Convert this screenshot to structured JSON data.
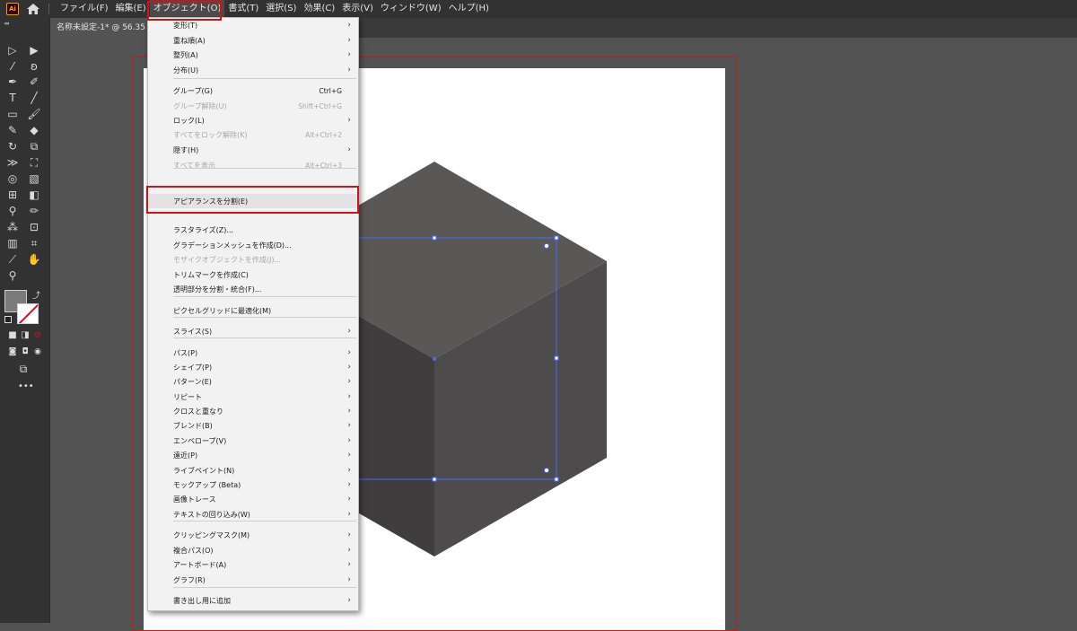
{
  "menubar": {
    "logo_text": "Ai",
    "items": [
      "ファイル(F)",
      "編集(E)",
      "オブジェクト(O)",
      "書式(T)",
      "選択(S)",
      "効果(C)",
      "表示(V)",
      "ウィンドウ(W)",
      "ヘルプ(H)"
    ]
  },
  "document": {
    "tab_title": "名称未設定-1* @ 56.35 %"
  },
  "object_menu": {
    "items": [
      {
        "label": "変形(T)",
        "shortcut": "",
        "submenu": true,
        "disabled": false
      },
      {
        "label": "重ね順(A)",
        "shortcut": "",
        "submenu": true,
        "disabled": false
      },
      {
        "label": "整列(A)",
        "shortcut": "",
        "submenu": true,
        "disabled": false
      },
      {
        "label": "分布(U)",
        "shortcut": "",
        "submenu": true,
        "disabled": false
      },
      {
        "label": "グループ(G)",
        "shortcut": "Ctrl+G",
        "submenu": false,
        "disabled": false
      },
      {
        "label": "グループ解除(U)",
        "shortcut": "Shift+Ctrl+G",
        "submenu": false,
        "disabled": true
      },
      {
        "label": "ロック(L)",
        "shortcut": "",
        "submenu": true,
        "disabled": false
      },
      {
        "label": "すべてをロック解除(K)",
        "shortcut": "Alt+Ctrl+2",
        "submenu": false,
        "disabled": true
      },
      {
        "label": "隠す(H)",
        "shortcut": "",
        "submenu": true,
        "disabled": false
      },
      {
        "label": "すべてを表示",
        "shortcut": "Alt+Ctrl+3",
        "submenu": false,
        "disabled": true
      },
      {
        "label": "アピアランスを分割(E)",
        "shortcut": "",
        "submenu": false,
        "disabled": false
      },
      {
        "label": "ラスタライズ(Z)...",
        "shortcut": "",
        "submenu": false,
        "disabled": false
      },
      {
        "label": "グラデーションメッシュを作成(D)...",
        "shortcut": "",
        "submenu": false,
        "disabled": false
      },
      {
        "label": "モザイクオブジェクトを作成(J)...",
        "shortcut": "",
        "submenu": false,
        "disabled": true
      },
      {
        "label": "トリムマークを作成(C)",
        "shortcut": "",
        "submenu": false,
        "disabled": false
      },
      {
        "label": "透明部分を分割・統合(F)...",
        "shortcut": "",
        "submenu": false,
        "disabled": false
      },
      {
        "label": "ピクセルグリッドに最適化(M)",
        "shortcut": "",
        "submenu": false,
        "disabled": false
      },
      {
        "label": "スライス(S)",
        "shortcut": "",
        "submenu": true,
        "disabled": false
      },
      {
        "label": "パス(P)",
        "shortcut": "",
        "submenu": true,
        "disabled": false
      },
      {
        "label": "シェイプ(P)",
        "shortcut": "",
        "submenu": true,
        "disabled": false
      },
      {
        "label": "パターン(E)",
        "shortcut": "",
        "submenu": true,
        "disabled": false
      },
      {
        "label": "リピート",
        "shortcut": "",
        "submenu": true,
        "disabled": false
      },
      {
        "label": "クロスと重なり",
        "shortcut": "",
        "submenu": true,
        "disabled": false
      },
      {
        "label": "ブレンド(B)",
        "shortcut": "",
        "submenu": true,
        "disabled": false
      },
      {
        "label": "エンベロープ(V)",
        "shortcut": "",
        "submenu": true,
        "disabled": false
      },
      {
        "label": "遠近(P)",
        "shortcut": "",
        "submenu": true,
        "disabled": false
      },
      {
        "label": "ライブペイント(N)",
        "shortcut": "",
        "submenu": true,
        "disabled": false
      },
      {
        "label": "モックアップ (Beta)",
        "shortcut": "",
        "submenu": true,
        "disabled": false
      },
      {
        "label": "画像トレース",
        "shortcut": "",
        "submenu": true,
        "disabled": false
      },
      {
        "label": "テキストの回り込み(W)",
        "shortcut": "",
        "submenu": true,
        "disabled": false
      },
      {
        "label": "クリッピングマスク(M)",
        "shortcut": "",
        "submenu": true,
        "disabled": false
      },
      {
        "label": "複合パス(O)",
        "shortcut": "",
        "submenu": true,
        "disabled": false
      },
      {
        "label": "アートボード(A)",
        "shortcut": "",
        "submenu": true,
        "disabled": false
      },
      {
        "label": "グラフ(R)",
        "shortcut": "",
        "submenu": true,
        "disabled": false
      },
      {
        "label": "書き出し用に追加",
        "shortcut": "",
        "submenu": true,
        "disabled": false
      }
    ]
  },
  "icons": {
    "home": "home-icon",
    "submenu_arrow": "›"
  },
  "colors": {
    "highlight_border": "#d0121b",
    "selection": "#4a6cf7",
    "cube_top": "#5a5757",
    "cube_left": "#3f3d3d",
    "cube_right": "#4d4b4b"
  }
}
